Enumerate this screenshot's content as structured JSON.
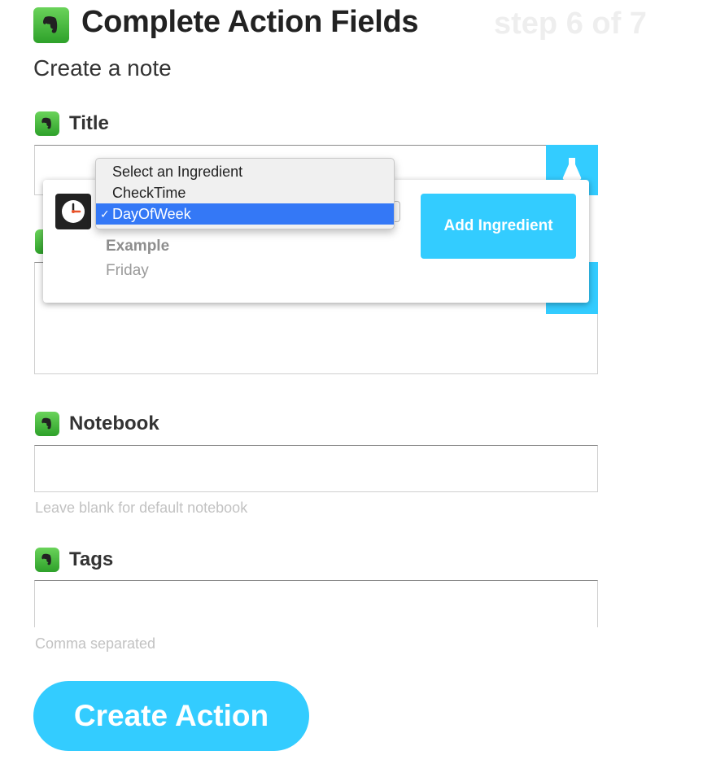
{
  "header": {
    "title": "Complete Action Fields",
    "step": "step 6 of 7",
    "icon": "evernote-icon"
  },
  "subtitle": "Create a note",
  "fields": {
    "title": {
      "label": "Title",
      "value": ""
    },
    "body": {
      "value": ""
    },
    "notebook": {
      "label": "Notebook",
      "value": "",
      "helper": "Leave blank for default notebook"
    },
    "tags": {
      "label": "Tags",
      "value": "",
      "helper": "Comma separated"
    }
  },
  "ingredient_popover": {
    "trigger_icon": "clock-icon",
    "dropdown_options": [
      "Select an Ingredient",
      "CheckTime",
      "DayOfWeek"
    ],
    "selected_option": "DayOfWeek",
    "check_mark": "✓",
    "example_label": "Example",
    "example_value": "Friday",
    "add_button_label": "Add Ingredient"
  },
  "create_button_label": "Create Action",
  "colors": {
    "accent": "#33ccff",
    "evernote_green": "#2ea12a",
    "selection_blue": "#3478f6"
  }
}
